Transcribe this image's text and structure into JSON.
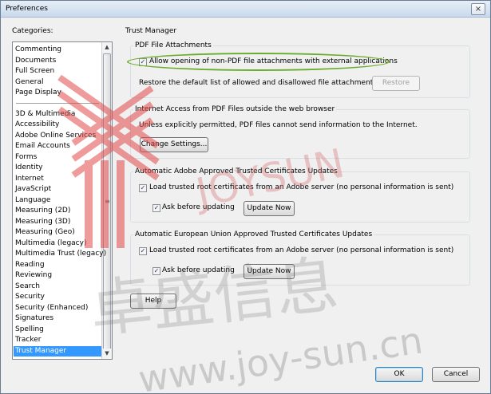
{
  "window": {
    "title": "Preferences",
    "close_glyph": "×"
  },
  "categories": {
    "label": "Categories:",
    "group1": [
      "Commenting",
      "Documents",
      "Full Screen",
      "General",
      "Page Display"
    ],
    "group2": [
      "3D & Multimedia",
      "Accessibility",
      "Adobe Online Services",
      "Email Accounts",
      "Forms",
      "Identity",
      "Internet",
      "JavaScript",
      "Language",
      "Measuring (2D)",
      "Measuring (3D)",
      "Measuring (Geo)",
      "Multimedia (legacy)",
      "Multimedia Trust (legacy)",
      "Reading",
      "Reviewing",
      "Search",
      "Security",
      "Security (Enhanced)",
      "Signatures",
      "Spelling",
      "Tracker",
      "Trust Manager"
    ],
    "selected": "Trust Manager"
  },
  "panel": {
    "title": "Trust Manager",
    "pdf_attachments": {
      "title": "PDF File Attachments",
      "allow_label": "Allow opening of non-PDF file attachments with external applications",
      "allow_checked": true,
      "restore_text": "Restore the default list of allowed and disallowed file attachment types:",
      "restore_button": "Restore"
    },
    "internet_access": {
      "title": "Internet Access from PDF Files outside the web browser",
      "info_text": "Unless explicitly permitted, PDF files cannot send information to the Internet.",
      "change_button": "Change Settings..."
    },
    "adobe_certs": {
      "title": "Automatic Adobe Approved Trusted Certificates Updates",
      "load_label": "Load trusted root certificates from an Adobe server (no personal information is sent)",
      "load_checked": true,
      "ask_label": "Ask before updating",
      "ask_checked": true,
      "update_button": "Update Now"
    },
    "eu_certs": {
      "title": "Automatic European Union Approved Trusted Certificates Updates",
      "load_label": "Load trusted root certificates from an Adobe server (no personal information is sent)",
      "load_checked": true,
      "ask_label": "Ask before updating",
      "ask_checked": true,
      "update_button": "Update Now"
    }
  },
  "footer": {
    "help_button": "Help",
    "ok_button": "OK",
    "cancel_button": "Cancel"
  },
  "watermark": {
    "brand": "JOYSUN",
    "chinese": "卓盛信息",
    "url": "www.joy-sun.cn"
  },
  "icons": {
    "check": "✓",
    "scroll_up": "▲",
    "scroll_down": "▼",
    "grip": "≡"
  },
  "colors": {
    "accent": "#3399ff",
    "highlight": "#6aad2a",
    "watermark": "#e24a4a"
  }
}
